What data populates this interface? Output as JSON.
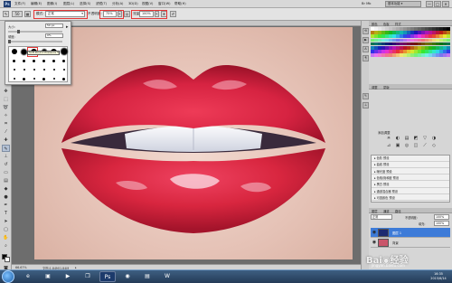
{
  "app": {
    "brand": "Ps",
    "workspace_label": "基本功能 ▾",
    "mini_label": "Br  Mb"
  },
  "menubar": {
    "items": [
      "文件(F)",
      "编辑(E)",
      "图像(I)",
      "图层(L)",
      "选择(S)",
      "滤镜(T)",
      "分析(A)",
      "3D(D)",
      "视图(V)",
      "窗口(W)",
      "帮助(H)"
    ]
  },
  "window_controls": [
    "—",
    "□",
    "✕"
  ],
  "options": {
    "brush_size": "50",
    "mode_label": "模式:",
    "mode_value": "正常",
    "opacity_label": "不透明度:",
    "opacity_value": "75%",
    "flow_label": "流量:",
    "flow_value": "100%"
  },
  "brush_panel": {
    "size_label": "大小:",
    "size_value": "50 px",
    "hardness_label": "硬度:",
    "hardness_value": "0%",
    "size_level": 0.18,
    "hardness_level": 0.0,
    "tooltip": "Soft Round Pressure Size",
    "brushes": [
      {
        "d": 6,
        "row": 0
      },
      {
        "d": 7,
        "row": 0
      },
      {
        "d": 7,
        "row": 0
      },
      {
        "d": 6,
        "row": 0
      },
      {
        "d": 7,
        "row": 0
      },
      {
        "d": 8,
        "row": 0
      },
      {
        "d": 3,
        "row": 1
      },
      {
        "d": 3,
        "row": 1
      },
      {
        "d": 3,
        "row": 1
      },
      {
        "d": 3,
        "row": 1
      },
      {
        "d": 3,
        "row": 1
      },
      {
        "d": 3,
        "row": 1
      },
      {
        "d": 2,
        "row": 2
      },
      {
        "d": 2,
        "row": 2
      },
      {
        "d": 2,
        "row": 2
      },
      {
        "d": 2,
        "row": 2
      },
      {
        "d": 2,
        "row": 2
      },
      {
        "d": 2,
        "row": 2
      },
      {
        "d": 2,
        "row": 3
      },
      {
        "d": 3,
        "row": 3
      },
      {
        "d": 2,
        "row": 3
      },
      {
        "d": 3,
        "row": 3
      },
      {
        "d": 2,
        "row": 3
      },
      {
        "d": 3,
        "row": 3
      }
    ]
  },
  "panels": {
    "top_tabs": [
      "颜色",
      "色板",
      "样式"
    ],
    "adjust_tabs": [
      "调整",
      "蒙版"
    ],
    "adjust_title": "添加调整",
    "adjust_icons": [
      "☀",
      "◐",
      "▤",
      "◩",
      "▽",
      "◑",
      "⊿",
      "▣",
      "◎",
      "◫",
      "⟋",
      "◇"
    ],
    "presets": [
      "▸ 色阶 预设",
      "▸ 曲线 预设",
      "▸ 曝光度 预设",
      "▸ 色相/饱和度 预设",
      "▸ 黑白 预设",
      "▸ 通道混合器 预设",
      "▸ 可选颜色 预设"
    ],
    "layers_tabs": [
      "图层",
      "通道",
      "路径"
    ],
    "blend_mode": "正常",
    "layer_opacity_label": "不透明度:",
    "layer_opacity": "100%",
    "fill_label": "填充:",
    "fill": "100%",
    "layers": [
      {
        "name": "图层 1",
        "selected": true,
        "thumb": "#1d2a70"
      },
      {
        "name": "背景",
        "selected": false,
        "thumb": "#c9566b"
      }
    ]
  },
  "status": {
    "zoom": "66.67%",
    "doc_info": "文档:1.84M/1.84M"
  },
  "taskbar": {
    "apps": [
      "e",
      "▣",
      "▶",
      "❐",
      "Ps",
      "◉",
      "▤",
      "W"
    ],
    "time": "16:35",
    "date": "2015/6/14"
  },
  "watermark": {
    "main": "Bai◉经验",
    "sub": "jingyan.baidu.com"
  },
  "colors": {
    "accent": "#e63535",
    "foreground": "#000000",
    "background": "#ffffff",
    "lip": "#d8283e",
    "selection": "#3d7bd8"
  }
}
